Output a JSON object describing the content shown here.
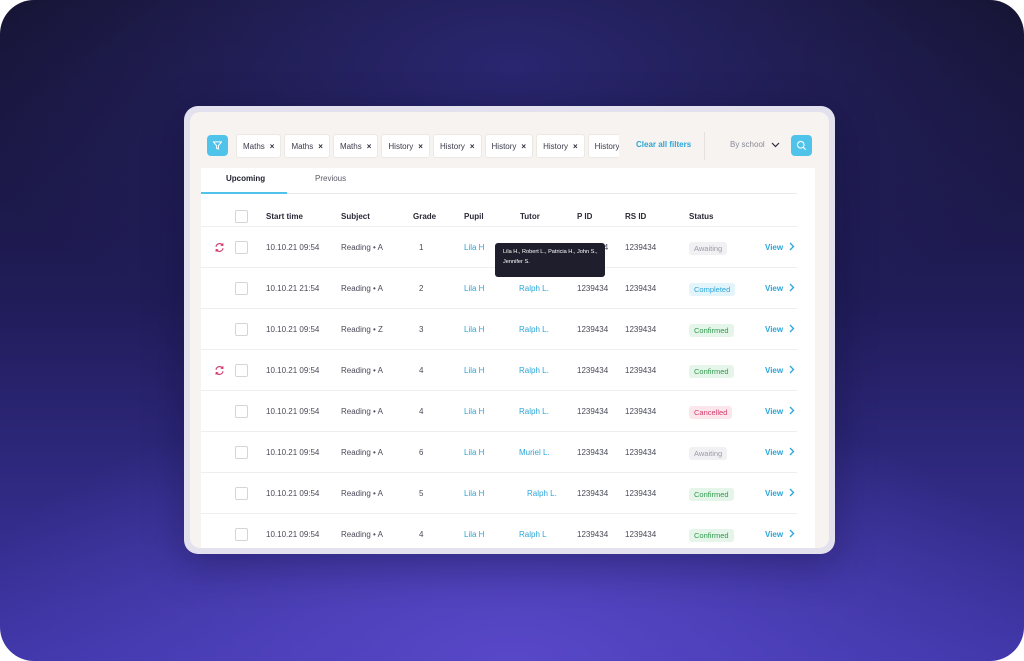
{
  "toolbar": {
    "filters": [
      {
        "label": "Maths"
      },
      {
        "label": "Maths"
      },
      {
        "label": "Maths"
      },
      {
        "label": "History"
      },
      {
        "label": "History"
      },
      {
        "label": "History"
      },
      {
        "label": "History"
      },
      {
        "label": "History"
      }
    ],
    "clear_all": "Clear all filters",
    "school_select": "By school"
  },
  "tabs": [
    {
      "label": "Upcoming",
      "active": true
    },
    {
      "label": "Previous",
      "active": false
    }
  ],
  "table": {
    "headers": {
      "start_time": "Start time",
      "subject": "Subject",
      "grade": "Grade",
      "pupil": "Pupil",
      "tutor": "Tutor",
      "pid": "P ID",
      "rsid": "RS ID",
      "status": "Status"
    },
    "view_label": "View",
    "rows": [
      {
        "sync": true,
        "start_time": "10.10.21 09:54",
        "subject": "Reading • A",
        "grade": "1",
        "pupil": "Lila H",
        "tutor": "",
        "pid": "1239434",
        "rsid": "1239434",
        "status": "Awaiting",
        "status_kind": "awaiting"
      },
      {
        "sync": false,
        "start_time": "10.10.21 21:54",
        "subject": "Reading • A",
        "grade": "2",
        "pupil": "Lila H",
        "tutor": "Ralph L.",
        "pid": "1239434",
        "rsid": "1239434",
        "status": "Completed",
        "status_kind": "completed"
      },
      {
        "sync": false,
        "start_time": "10.10.21 09:54",
        "subject": "Reading • Z",
        "grade": "3",
        "pupil": "Lila H",
        "tutor": "Ralph L.",
        "pid": "1239434",
        "rsid": "1239434",
        "status": "Confirmed",
        "status_kind": "confirmed"
      },
      {
        "sync": true,
        "start_time": "10.10.21 09:54",
        "subject": "Reading • A",
        "grade": "4",
        "pupil": "Lila H",
        "tutor": "Ralph L.",
        "pid": "1239434",
        "rsid": "1239434",
        "status": "Confirmed",
        "status_kind": "confirmed"
      },
      {
        "sync": false,
        "start_time": "10.10.21 09:54",
        "subject": "Reading • A",
        "grade": "4",
        "pupil": "Lila H",
        "tutor": "Ralph L.",
        "pid": "1239434",
        "rsid": "1239434",
        "status": "Cancelled",
        "status_kind": "cancelled"
      },
      {
        "sync": false,
        "start_time": "10.10.21 09:54",
        "subject": "Reading • A",
        "grade": "6",
        "pupil": "Lila H",
        "tutor": "Muriel L.",
        "pid": "1239434",
        "rsid": "1239434",
        "status": "Awaiting",
        "status_kind": "awaiting"
      },
      {
        "sync": false,
        "start_time": "10.10.21 09:54",
        "subject": "Reading • A",
        "grade": "5",
        "pupil": "Lila H",
        "tutor": "Ralph L.",
        "pid": "1239434",
        "rsid": "1239434",
        "status": "Confirmed",
        "status_kind": "confirmed"
      },
      {
        "sync": false,
        "start_time": "10.10.21 09:54",
        "subject": "Reading • A",
        "grade": "4",
        "pupil": "Lila H",
        "tutor": "Ralph L",
        "pid": "1239434",
        "rsid": "1239434",
        "status": "Confirmed",
        "status_kind": "confirmed"
      }
    ]
  },
  "tooltip": {
    "line1": "Lila H.,  Robert L.,  Patricia H.,  John S.,",
    "line2": "Jennifer S."
  },
  "colors": {
    "accent": "#4fc3ea",
    "link": "#2ba6d8",
    "sync_icon": "#d23a6a"
  }
}
